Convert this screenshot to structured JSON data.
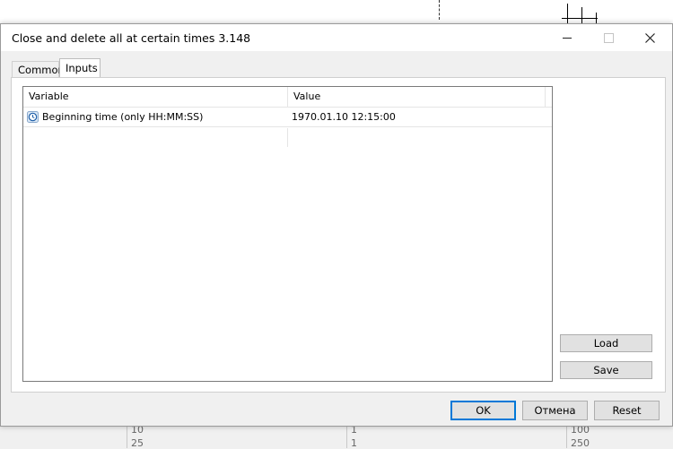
{
  "window": {
    "title": "Close and delete all at certain times 3.148"
  },
  "tabs": [
    {
      "label": "Common",
      "active": false
    },
    {
      "label": "Inputs",
      "active": true
    }
  ],
  "table": {
    "headers": {
      "variable": "Variable",
      "value": "Value"
    },
    "rows": [
      {
        "icon": "clock-icon",
        "variable": "Beginning time (only HH:MM:SS)",
        "value": "1970.01.10 12:15:00"
      }
    ]
  },
  "side_buttons": {
    "load": "Load",
    "save": "Save"
  },
  "footer_buttons": {
    "ok": "OK",
    "cancel": "Отмена",
    "reset": "Reset"
  },
  "background": {
    "cells": [
      "10",
      "1",
      "100",
      "25",
      "1",
      "250"
    ]
  },
  "colors": {
    "accent": "#0078d7",
    "dialog_bg": "#f0f0f0"
  }
}
